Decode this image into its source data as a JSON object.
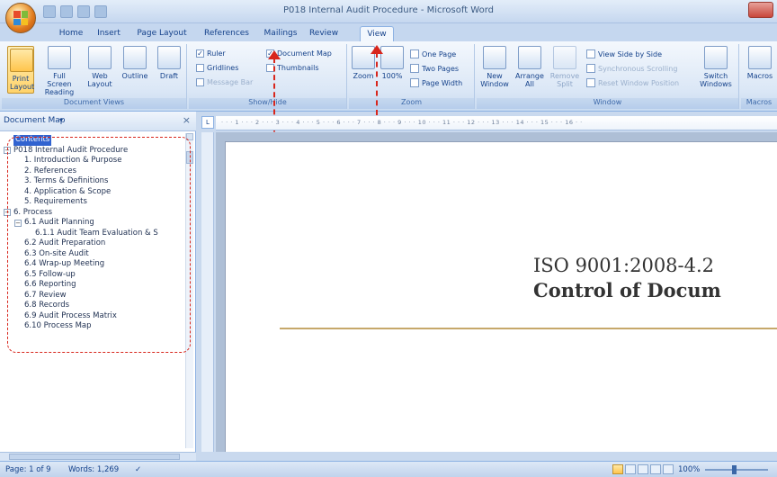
{
  "window": {
    "title": "P018 Internal Audit Procedure - Microsoft Word"
  },
  "tabs": [
    {
      "label": "Home",
      "left": 0
    },
    {
      "label": "Insert"
    },
    {
      "label": "Page Layout"
    },
    {
      "label": "References"
    },
    {
      "label": "Mailings"
    },
    {
      "label": "Review"
    },
    {
      "label": "View",
      "active": true
    }
  ],
  "ribbon": {
    "document_views": {
      "label": "Document Views",
      "print_layout": "Print Layout",
      "full_screen_reading": "Full Screen Reading",
      "web_layout": "Web Layout",
      "outline": "Outline",
      "draft": "Draft"
    },
    "show_hide": {
      "label": "Show/Hide",
      "ruler": "Ruler",
      "gridlines": "Gridlines",
      "message_bar": "Message Bar",
      "document_map": "Document Map",
      "thumbnails": "Thumbnails"
    },
    "zoom": {
      "label": "Zoom",
      "zoom": "Zoom",
      "hundred": "100%",
      "one_page": "One Page",
      "two_pages": "Two Pages",
      "page_width": "Page Width"
    },
    "window": {
      "label": "Window",
      "new_window": "New Window",
      "arrange_all": "Arrange All",
      "remove_split": "Remove Split",
      "view_side_by_side": "View Side by Side",
      "synchronous_scrolling": "Synchronous Scrolling",
      "reset_window_position": "Reset Window Position",
      "switch_windows": "Switch Windows"
    },
    "macros": {
      "label": "Macros",
      "macros": "Macros"
    }
  },
  "docmap": {
    "title": "Document Map",
    "items": [
      {
        "label": "Contents",
        "indent": 0,
        "selected": true,
        "expander": ""
      },
      {
        "label": "P018 Internal Audit Procedure",
        "indent": 0,
        "expander": "−"
      },
      {
        "label": "1. Introduction & Purpose",
        "indent": 1,
        "expander": ""
      },
      {
        "label": "2. References",
        "indent": 1,
        "expander": ""
      },
      {
        "label": "3. Terms & Definitions",
        "indent": 1,
        "expander": ""
      },
      {
        "label": "4. Application & Scope",
        "indent": 1,
        "expander": ""
      },
      {
        "label": "5. Requirements",
        "indent": 1,
        "expander": ""
      },
      {
        "label": "6. Process",
        "indent": 0,
        "expander": "−"
      },
      {
        "label": "6.1 Audit Planning",
        "indent": 1,
        "expander": "−"
      },
      {
        "label": "6.1.1 Audit Team Evaluation & S",
        "indent": 2,
        "expander": ""
      },
      {
        "label": "6.2 Audit Preparation",
        "indent": 1,
        "expander": ""
      },
      {
        "label": "6.3 On-site Audit",
        "indent": 1,
        "expander": ""
      },
      {
        "label": "6.4 Wrap-up Meeting",
        "indent": 1,
        "expander": ""
      },
      {
        "label": "6.5 Follow-up",
        "indent": 1,
        "expander": ""
      },
      {
        "label": "6.6 Reporting",
        "indent": 1,
        "expander": ""
      },
      {
        "label": "6.7 Review",
        "indent": 1,
        "expander": ""
      },
      {
        "label": "6.8 Records",
        "indent": 1,
        "expander": ""
      },
      {
        "label": "6.9 Audit Process Matrix",
        "indent": 1,
        "expander": ""
      },
      {
        "label": "6.10 Process Map",
        "indent": 1,
        "expander": ""
      }
    ]
  },
  "ruler_text": "· · · 1 · · · 2 · · · 3 · · · 4 · · · 5 · · · 6 · · · 7 · · · 8 · · · 9 · · · 10 · · · 11 · · · 12 · · · 13 · · · 14 · · · 15 · · · 16 · ·",
  "document": {
    "line1": "ISO 9001:2008-4.2",
    "line2": "Control of Docum"
  },
  "status": {
    "page": "Page: 1 of 9",
    "words": "Words: 1,269",
    "zoom": "100%"
  },
  "colors": {
    "accent": "#15428b",
    "annotation": "#d8261c"
  }
}
